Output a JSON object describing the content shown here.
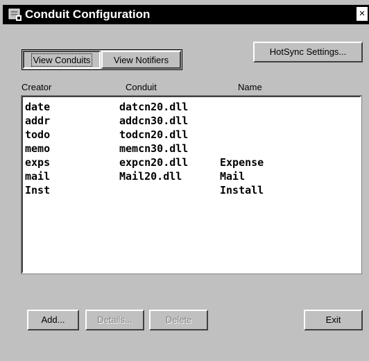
{
  "window": {
    "title": "Conduit Configuration",
    "close_glyph": "×"
  },
  "tabs": {
    "view_conduits": "View Conduits",
    "view_notifiers": "View Notifiers"
  },
  "hotsync_button": "HotSync Settings...",
  "columns": {
    "creator": "Creator",
    "conduit": "Conduit",
    "name": "Name"
  },
  "rows": [
    {
      "creator": "date",
      "conduit": "datcn20.dll",
      "name": ""
    },
    {
      "creator": "addr",
      "conduit": "addcn30.dll",
      "name": ""
    },
    {
      "creator": "todo",
      "conduit": "todcn20.dll",
      "name": ""
    },
    {
      "creator": "memo",
      "conduit": "memcn30.dll",
      "name": ""
    },
    {
      "creator": "exps",
      "conduit": "expcn20.dll",
      "name": "Expense"
    },
    {
      "creator": "mail",
      "conduit": "Mail20.dll",
      "name": "Mail"
    },
    {
      "creator": "Inst",
      "conduit": "",
      "name": "Install"
    }
  ],
  "buttons": {
    "add": "Add...",
    "details": "Details...",
    "delete": "Delete",
    "exit": "Exit"
  },
  "colors": {
    "face": "#c0c0c0",
    "titlebar": "#000000",
    "list_bg": "#ffffff"
  }
}
